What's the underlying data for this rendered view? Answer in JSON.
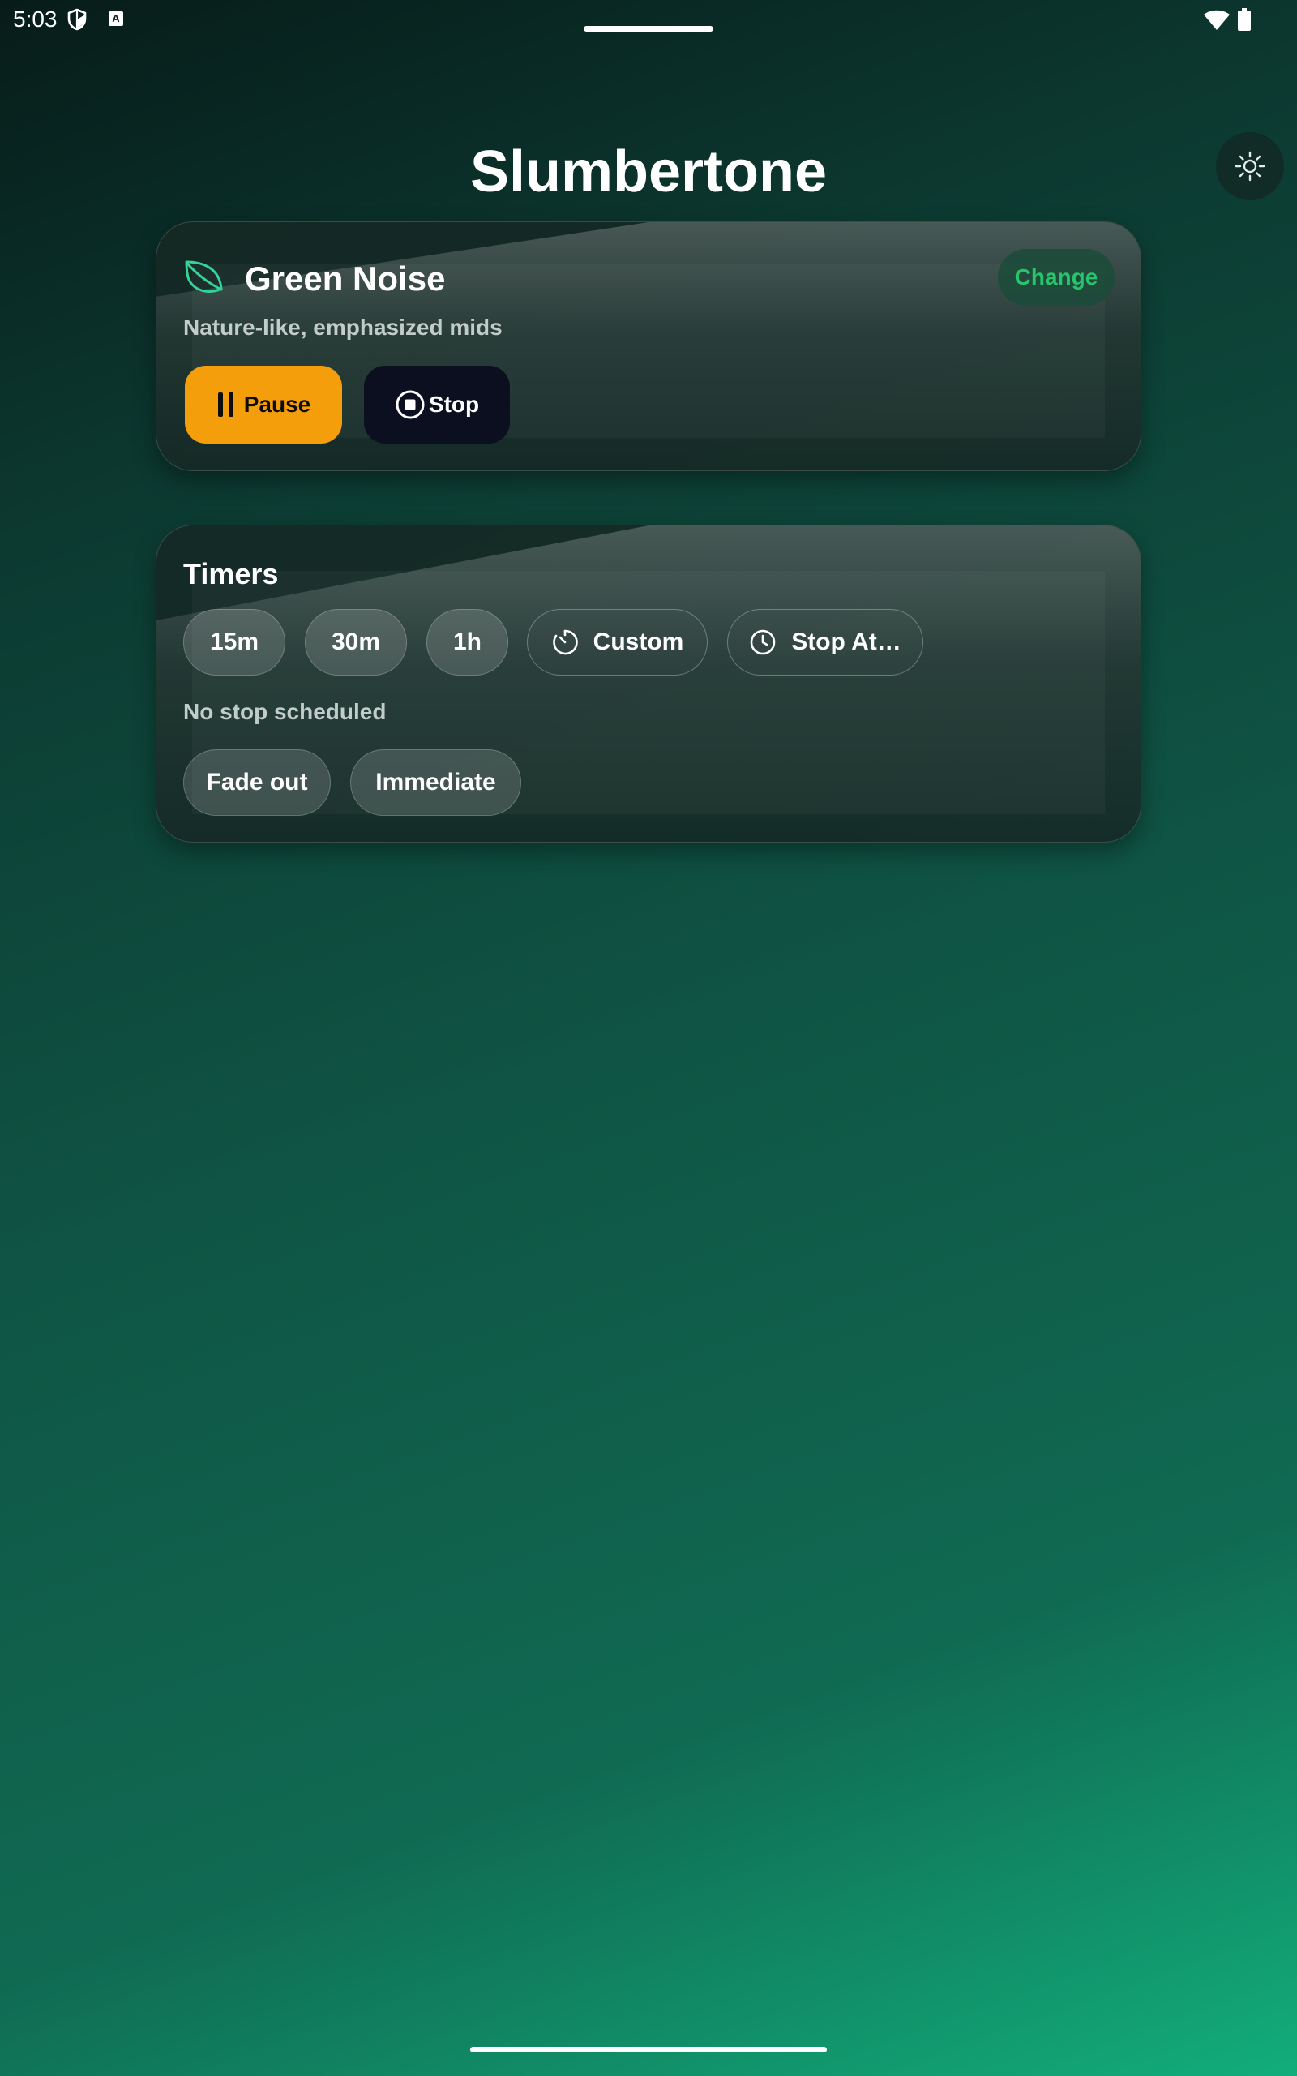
{
  "status_bar": {
    "time": "5:03",
    "notification_icon_label": "A",
    "icons": [
      "shield-icon",
      "a-notification-icon",
      "wifi-icon",
      "battery-icon"
    ]
  },
  "app": {
    "title": "Slumbertone",
    "theme_toggle_icon": "sun-icon"
  },
  "now_playing": {
    "icon": "leaf-icon",
    "sound_name": "Green Noise",
    "description": "Nature-like, emphasized mids",
    "change_label": "Change",
    "pause_label": "Pause",
    "stop_label": "Stop"
  },
  "timers": {
    "title": "Timers",
    "presets": [
      "15m",
      "30m",
      "1h"
    ],
    "custom_label": "Custom",
    "stop_at_label": "Stop At…",
    "status": "No stop scheduled",
    "modes": [
      "Fade out",
      "Immediate"
    ]
  },
  "colors": {
    "accent_green": "#27c46c",
    "pause_orange": "#f59e0b",
    "stop_navy": "#0b0f1f",
    "background_top": "#071c19",
    "background_bottom": "#12ad7a"
  }
}
